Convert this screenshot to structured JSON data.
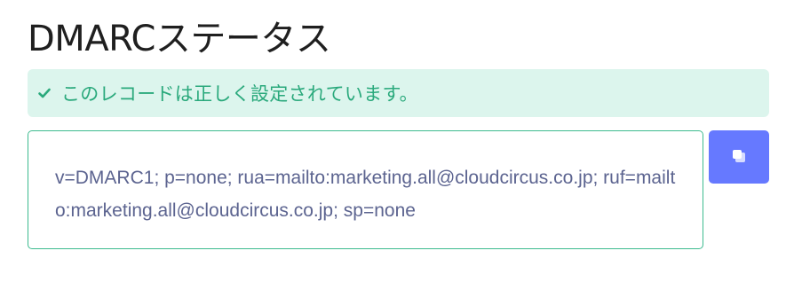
{
  "page": {
    "title": "DMARCステータス"
  },
  "status": {
    "message": "このレコードは正しく設定されています。",
    "icon": "check-icon",
    "color": "#2aa97c",
    "background": "#dcf5ed"
  },
  "record": {
    "value": "v=DMARC1; p=none; rua=mailto:marketing.all@cloudcircus.co.jp; ruf=mailto:marketing.all@cloudcircus.co.jp; sp=none",
    "border_color": "#3dbb8f"
  },
  "copy_button": {
    "icon": "copy-icon",
    "color": "#6679ff"
  }
}
